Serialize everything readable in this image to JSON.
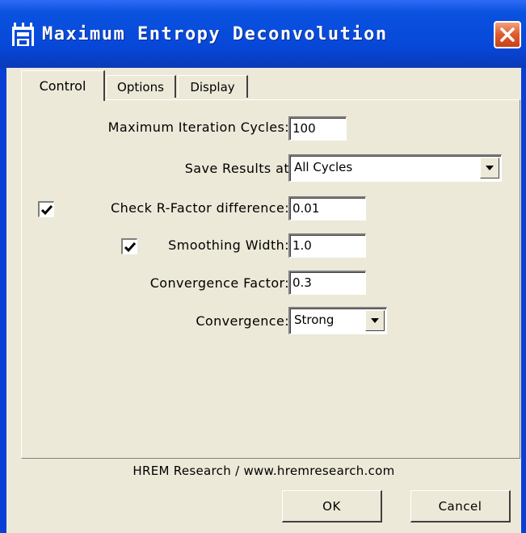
{
  "window": {
    "title": "Maximum Entropy Deconvolution"
  },
  "tabs": [
    {
      "label": "Control",
      "active": true
    },
    {
      "label": "Options",
      "active": false
    },
    {
      "label": "Display",
      "active": false
    }
  ],
  "form": {
    "max_iter_label": "Maximum Iteration Cycles:",
    "max_iter_value": "100",
    "save_results_label": "Save Results at",
    "save_results_value": "All Cycles",
    "check_r_factor_label": "Check R-Factor difference:",
    "check_r_factor_checked": true,
    "check_r_factor_value": "0.01",
    "smoothing_label": "Smoothing Width:",
    "smoothing_checked": true,
    "smoothing_value": "1.0",
    "conv_factor_label": "Convergence Factor:",
    "conv_factor_value": "0.3",
    "convergence_label": "Convergence:",
    "convergence_value": "Strong"
  },
  "footer": {
    "credit": "HREM Research / www.hremresearch.com",
    "ok_label": "OK",
    "cancel_label": "Cancel"
  },
  "colors": {
    "titlebar": "#0747d8",
    "dialog_face": "#ece9d8",
    "close_button": "#de5a2c"
  }
}
